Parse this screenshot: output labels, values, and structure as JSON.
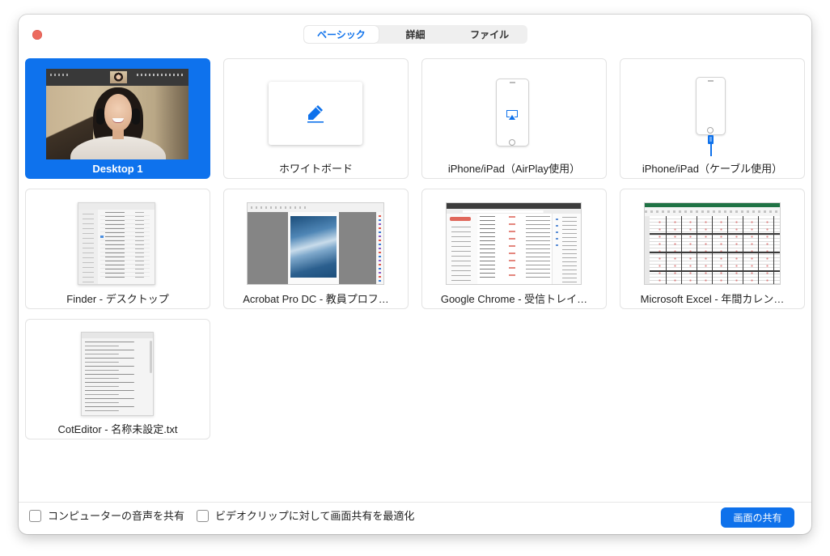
{
  "tabs": [
    {
      "label": "ベーシック",
      "selected": true
    },
    {
      "label": "詳細",
      "selected": false
    },
    {
      "label": "ファイル",
      "selected": false
    }
  ],
  "tiles": [
    {
      "label": "Desktop 1",
      "selected": true
    },
    {
      "label": "ホワイトボード",
      "icon": "pencil-icon",
      "selected": false
    },
    {
      "label": "iPhone/iPad（AirPlay使用）",
      "icon": "airplay-icon",
      "selected": false
    },
    {
      "label": "iPhone/iPad（ケーブル使用）",
      "icon": "lightning-cable-icon",
      "selected": false
    },
    {
      "label": "Finder - デスクトップ",
      "selected": false
    },
    {
      "label": "Acrobat Pro DC - 教員プロフ…",
      "selected": false
    },
    {
      "label": "Google Chrome - 受信トレイ…",
      "selected": false
    },
    {
      "label": "Microsoft Excel - 年間カレン…",
      "selected": false
    },
    {
      "label": "CotEditor - 名称未設定.txt",
      "selected": false
    }
  ],
  "footer": {
    "share_audio_label": "コンピューターの音声を共有",
    "share_audio_checked": false,
    "optimize_video_label": "ビデオクリップに対して画面共有を最適化",
    "optimize_video_checked": false,
    "share_button_label": "画面の共有"
  },
  "colors": {
    "accent": "#0E71EB",
    "selected_tile": "#0E72ED",
    "close_button": "#EC6A5E"
  }
}
